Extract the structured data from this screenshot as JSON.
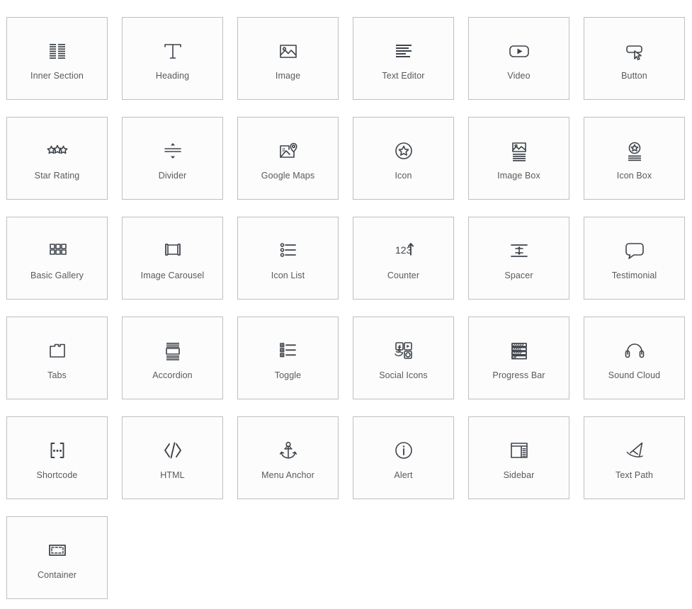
{
  "panel": {
    "title": "Elementor Widgets Panel",
    "columns": 6,
    "accent_color": "#3f444b",
    "label_color": "#5a5a5a",
    "card_border_color": "#bfbfbf",
    "card_background": "#fcfcfc",
    "page_background": "#ffffff"
  },
  "widgets": [
    {
      "label": "Inner Section",
      "icon": "inner-section-icon"
    },
    {
      "label": "Heading",
      "icon": "heading-icon"
    },
    {
      "label": "Image",
      "icon": "image-icon"
    },
    {
      "label": "Text Editor",
      "icon": "text-editor-icon"
    },
    {
      "label": "Video",
      "icon": "video-icon"
    },
    {
      "label": "Button",
      "icon": "button-icon"
    },
    {
      "label": "Star Rating",
      "icon": "star-rating-icon"
    },
    {
      "label": "Divider",
      "icon": "divider-icon"
    },
    {
      "label": "Google Maps",
      "icon": "google-maps-icon"
    },
    {
      "label": "Icon",
      "icon": "icon-star-circle-icon"
    },
    {
      "label": "Image Box",
      "icon": "image-box-icon"
    },
    {
      "label": "Icon Box",
      "icon": "icon-box-icon"
    },
    {
      "label": "Basic Gallery",
      "icon": "basic-gallery-icon"
    },
    {
      "label": "Image Carousel",
      "icon": "image-carousel-icon"
    },
    {
      "label": "Icon List",
      "icon": "icon-list-icon"
    },
    {
      "label": "Counter",
      "icon": "counter-icon"
    },
    {
      "label": "Spacer",
      "icon": "spacer-icon"
    },
    {
      "label": "Testimonial",
      "icon": "testimonial-icon"
    },
    {
      "label": "Tabs",
      "icon": "tabs-icon"
    },
    {
      "label": "Accordion",
      "icon": "accordion-icon"
    },
    {
      "label": "Toggle",
      "icon": "toggle-icon"
    },
    {
      "label": "Social Icons",
      "icon": "social-icons-icon"
    },
    {
      "label": "Progress Bar",
      "icon": "progress-bar-icon"
    },
    {
      "label": "Sound Cloud",
      "icon": "sound-cloud-icon"
    },
    {
      "label": "Shortcode",
      "icon": "shortcode-icon"
    },
    {
      "label": "HTML",
      "icon": "html-icon"
    },
    {
      "label": "Menu Anchor",
      "icon": "menu-anchor-icon"
    },
    {
      "label": "Alert",
      "icon": "alert-icon"
    },
    {
      "label": "Sidebar",
      "icon": "sidebar-icon"
    },
    {
      "label": "Text Path",
      "icon": "text-path-icon"
    },
    {
      "label": "Container",
      "icon": "container-icon"
    }
  ]
}
